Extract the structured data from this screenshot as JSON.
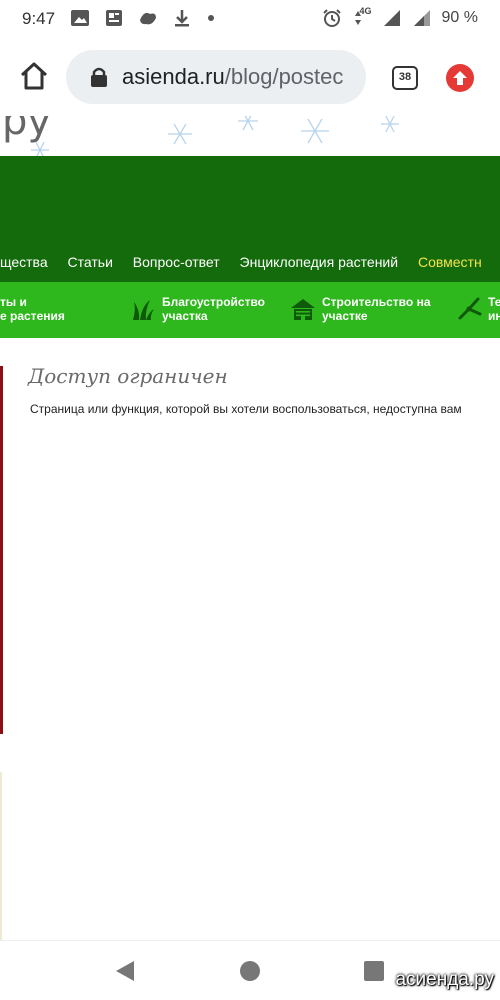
{
  "status_bar": {
    "time": "9:47",
    "network": "4G",
    "battery": "90 %",
    "icons_left": [
      "image-icon",
      "news-icon",
      "game-icon",
      "download-icon",
      "dot-icon"
    ],
    "icons_right": [
      "alarm-icon",
      "data-arrows-icon",
      "signal-icon",
      "signal-x-icon"
    ]
  },
  "browser": {
    "url_host": "asienda.ru",
    "url_path": "/blog/postec",
    "tab_count": "38",
    "colors": {
      "update_button": "#e53935",
      "url_bg": "#eceff1"
    }
  },
  "site": {
    "logo_fragment": "ру",
    "colors": {
      "header": "#136b0b",
      "category_bar": "#2eb81d",
      "nav_highlight": "#f7e24b"
    },
    "top_nav": [
      {
        "label": "щества"
      },
      {
        "label": "Статьи"
      },
      {
        "label": "Вопрос-ответ"
      },
      {
        "label": "Энциклопедия растений"
      },
      {
        "label": "Совместн"
      }
    ],
    "categories": [
      {
        "line1": "ты и",
        "line2": "е растения",
        "icon": ""
      },
      {
        "line1": "Благоустройство",
        "line2": "участка",
        "icon": "grass-icon"
      },
      {
        "line1": "Строительство на",
        "line2": "участке",
        "icon": "house-icon"
      },
      {
        "line1": "Те",
        "line2": "ин",
        "icon": "pruner-icon"
      }
    ]
  },
  "content": {
    "title": "Доступ ограничен",
    "message": "Страница или функция, которой вы хотели воспользоваться, недоступна вам"
  },
  "navigation": {
    "buttons": [
      "back-icon",
      "home-icon",
      "recents-icon"
    ],
    "watermark": "асиенда.ру"
  }
}
